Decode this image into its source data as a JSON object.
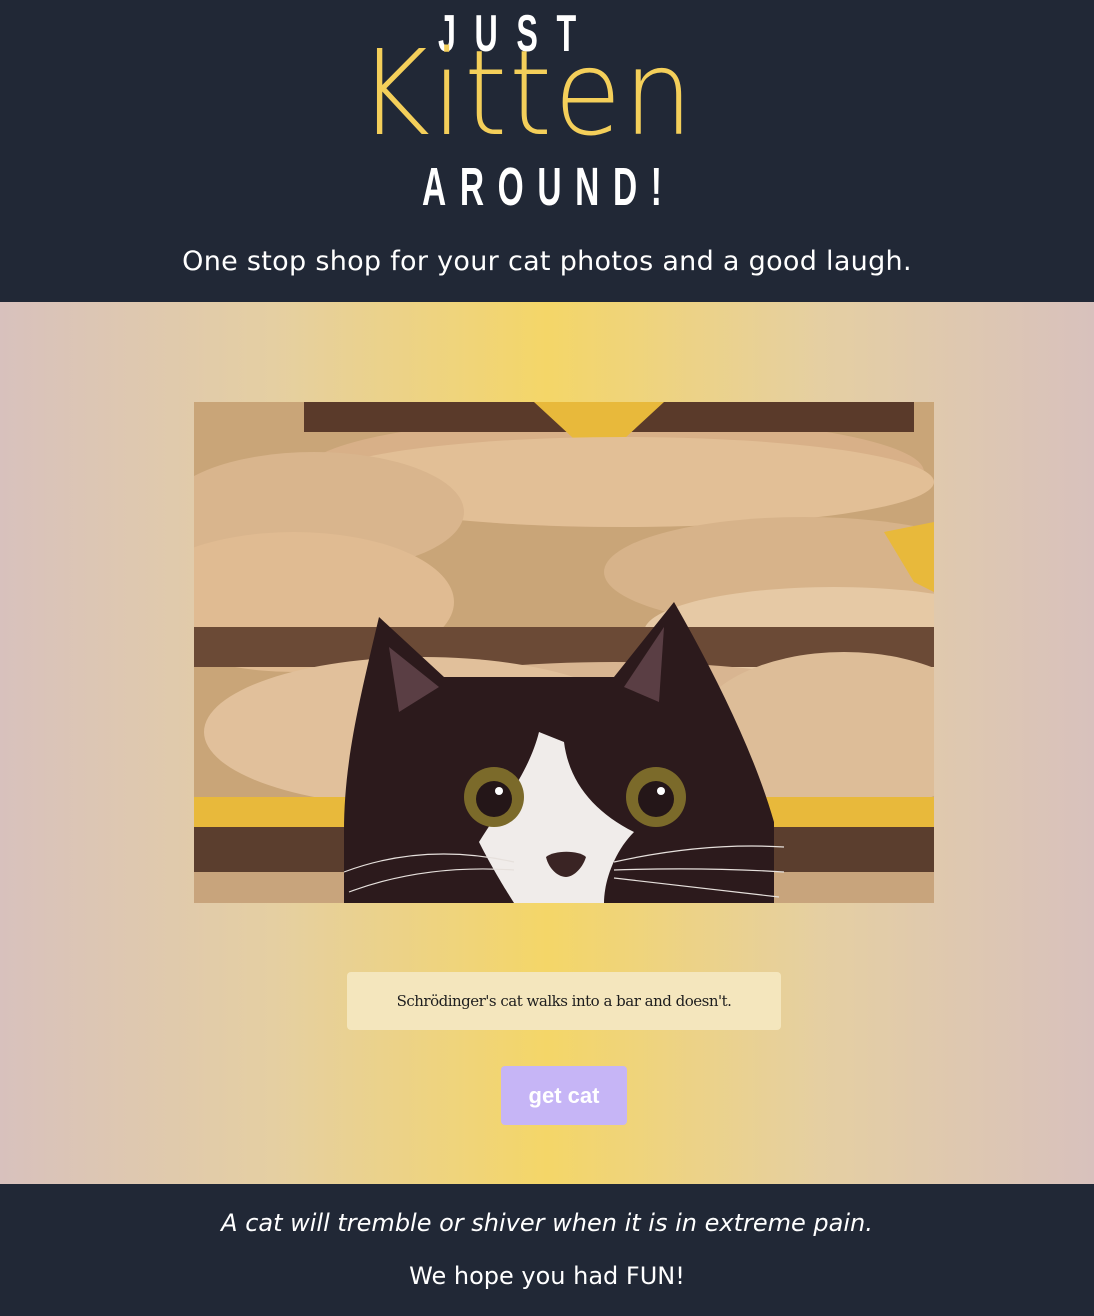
{
  "header": {
    "logo": {
      "top": "JUST",
      "middle": "Kitten",
      "bottom": "AROUND!"
    },
    "tagline": "One stop shop for your cat photos and a good laugh."
  },
  "main": {
    "joke": "Schrödinger's cat walks into a bar and doesn't.",
    "button_label": "get cat"
  },
  "footer": {
    "fact": "A cat will tremble or shiver when it is in extreme pain.",
    "goodbye": "We hope you had FUN!"
  },
  "colors": {
    "header_bg": "#212836",
    "logo_accent": "#f4cf5a",
    "button_bg": "#c6b5f6",
    "joke_bg": "#f4e6bd"
  }
}
